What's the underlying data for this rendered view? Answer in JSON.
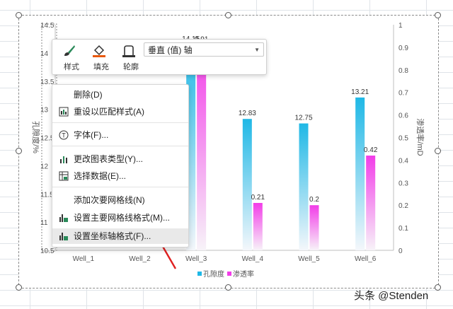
{
  "chart_data": {
    "type": "bar",
    "categories": [
      "Well_1",
      "Well_2",
      "Well_3",
      "Well_4",
      "Well_5",
      "Well_6"
    ],
    "series": [
      {
        "name": "孔隙度",
        "axis": "left",
        "color": "#1fb8e6",
        "values": [
          null,
          null,
          14.15,
          12.83,
          12.75,
          13.21
        ],
        "labels": [
          "",
          "",
          "14.15",
          "12.83",
          "12.75",
          "13.21"
        ]
      },
      {
        "name": "渗透率",
        "axis": "right",
        "color": "#f23de8",
        "values": [
          null,
          null,
          0.91,
          0.21,
          0.2,
          0.42
        ],
        "labels": [
          "",
          "",
          "0.91",
          "0.21",
          "0.2",
          "0.42"
        ]
      }
    ],
    "left_axis": {
      "title": "孔隙度/%",
      "min": 10.5,
      "max": 14.5,
      "ticks": [
        "10.5",
        "11",
        "11.5",
        "12",
        "12.5",
        "13",
        "13.5",
        "14",
        "14.5"
      ]
    },
    "right_axis": {
      "title": "渗透率/mD",
      "min": 0,
      "max": 1,
      "ticks": [
        "0",
        "0.1",
        "0.2",
        "0.3",
        "0.4",
        "0.5",
        "0.6",
        "0.7",
        "0.8",
        "0.9",
        "1"
      ]
    },
    "grid": false,
    "legend": "bottom"
  },
  "toolbar": {
    "style_label": "样式",
    "fill_label": "填充",
    "outline_label": "轮廓",
    "axis_select": "垂直 (值) 轴"
  },
  "context_menu": {
    "items": [
      {
        "label": "删除(D)",
        "icon": "none"
      },
      {
        "label": "重设以匹配样式(A)",
        "icon": "reset-style-icon"
      },
      {
        "label": "字体(F)...",
        "icon": "font-icon"
      },
      {
        "label": "更改图表类型(Y)...",
        "icon": "chart-type-icon"
      },
      {
        "label": "选择数据(E)...",
        "icon": "select-data-icon"
      },
      {
        "label": "添加次要网格线(N)",
        "icon": "none"
      },
      {
        "label": "设置主要网格线格式(M)...",
        "icon": "gridline-format-icon"
      },
      {
        "label": "设置坐标轴格式(F)...",
        "icon": "axis-format-icon"
      }
    ]
  },
  "colors": {
    "highlight_arrow": "#e02020"
  },
  "watermark": "头条 @Stenden"
}
